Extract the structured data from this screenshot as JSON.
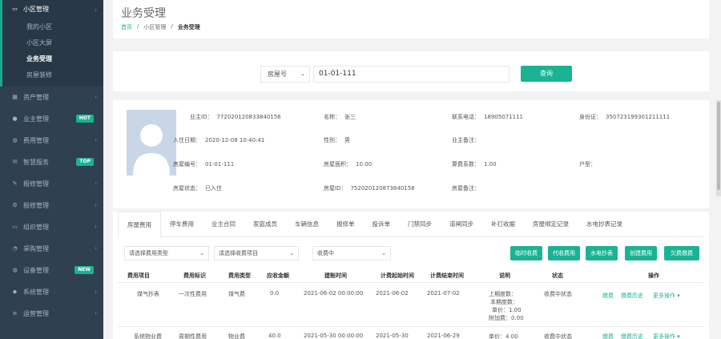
{
  "sidebar": {
    "items": [
      {
        "label": "小区管理",
        "icon": "monitor-icon"
      },
      {
        "label": "资产管理",
        "icon": "grid-icon"
      },
      {
        "label": "业主管理",
        "icon": "user-icon",
        "badge": "HOT"
      },
      {
        "label": "费用管理",
        "icon": "globe-icon"
      },
      {
        "label": "智慧服务",
        "icon": "envelope-icon",
        "badge": "TOP"
      },
      {
        "label": "报修管理",
        "icon": "wrench-icon"
      },
      {
        "label": "报修管理",
        "icon": "gear-icon"
      },
      {
        "label": "组织管理",
        "icon": "desktop-icon"
      },
      {
        "label": "采购管理",
        "icon": "cart-icon"
      },
      {
        "label": "设备管理",
        "icon": "globe-icon",
        "badge": "NEW"
      },
      {
        "label": "系统管理",
        "icon": "diamond-icon"
      },
      {
        "label": "运营管理",
        "icon": "bars-icon"
      }
    ],
    "subitems": [
      "我的小区",
      "小区大屏",
      "业务受理",
      "房屋装修"
    ],
    "badge_colors": {
      "HOT": "#1ab394",
      "TOP": "#1ab394",
      "NEW": "#1ab394"
    }
  },
  "header": {
    "title": "业务受理",
    "breadcrumb": [
      "首页",
      "小区管理",
      "业务受理"
    ]
  },
  "search": {
    "type_label": "房屋号",
    "value": "01-01-111",
    "button": "查询"
  },
  "info": {
    "rows": [
      [
        [
          "业主ID：",
          "772020120833840156"
        ],
        [
          "名称：",
          "张三"
        ],
        [
          "联系电话：",
          "18905071111"
        ],
        [
          "身份证：",
          "350723199301211111"
        ]
      ],
      [
        [
          "入住日期：",
          "2020-12-08 10:40:41"
        ],
        [
          "性别：",
          "男"
        ],
        [
          "业主备注：",
          ""
        ],
        [
          "",
          ""
        ]
      ],
      [
        [
          "房屋编号：",
          "01-01-111"
        ],
        [
          "房屋面积：",
          "10.00"
        ],
        [
          "算费系数：",
          "1.00"
        ],
        [
          "户型：",
          ""
        ]
      ],
      [
        [
          "房屋状态：",
          "已入住"
        ],
        [
          "房屋ID：",
          "752020120873840158"
        ],
        [
          "房屋备注：",
          ""
        ],
        [
          "",
          ""
        ]
      ]
    ]
  },
  "tabs": [
    "房屋费用",
    "停车费用",
    "业主合同",
    "家庭成员",
    "车辆信息",
    "报修单",
    "投诉单",
    "门禁同步",
    "道闸同步",
    "补打收据",
    "房屋绑定记录",
    "水电抄表记录"
  ],
  "filters": [
    "请选择费用类型",
    "请选择收费项目",
    "收费中"
  ],
  "actions": [
    "临时收费",
    "代收费用",
    "水电抄表",
    "创建费用",
    "欠费缴费"
  ],
  "table": {
    "headers": [
      "费用项目",
      "费用标识",
      "费用类型",
      "应收金额",
      "建账时间",
      "计费起始时间",
      "计费结束时间",
      "说明",
      "状态",
      "操作"
    ],
    "rows": [
      {
        "item": "煤气抄表",
        "flag": "一次性费用",
        "type": "煤气费",
        "amount": "0.0",
        "created": "2021-06-02 00:00:00",
        "start": "2021-06-02",
        "end": "2021-07-02",
        "desc": [
          "上期度数：",
          "本期度数：",
          "单价：1.00",
          "附加费：0.00"
        ],
        "status": "收费中状态",
        "ops": [
          "缴费",
          "缴费历史",
          "更多操作 ▾"
        ]
      },
      {
        "item": "系统物业费",
        "flag": "周期性费用",
        "type": "物业费",
        "amount": "40.0",
        "created": "2021-05-30 00:00:00",
        "start": "2021-05-30",
        "end": "2021-06-29",
        "desc": [
          "单价：4.00"
        ],
        "status": "收费中状态",
        "ops": [
          "缴费",
          "缴费历史",
          "更多操作 ▾"
        ]
      }
    ]
  },
  "colors": {
    "sidebar_bg": "#2f4050",
    "accent": "#1ab394",
    "panel_bg": "#ffffff"
  }
}
